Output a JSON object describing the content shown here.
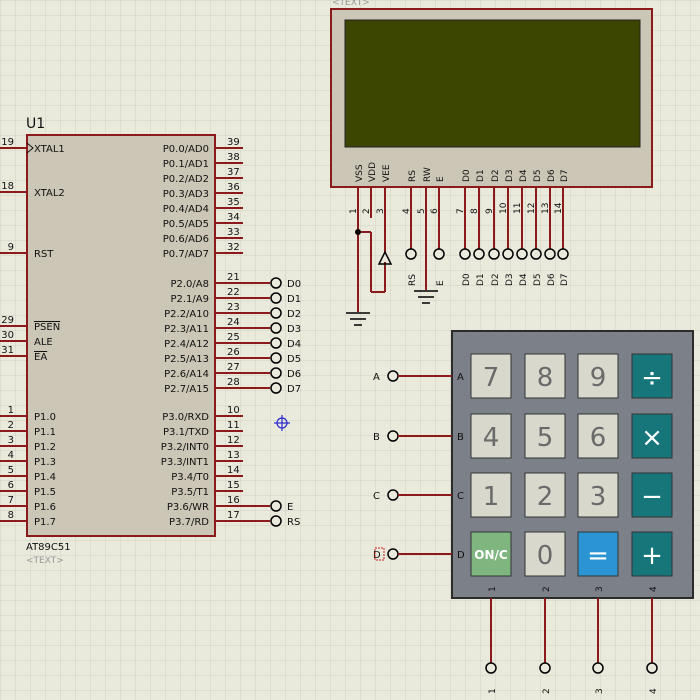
{
  "mcu": {
    "ref": "U1",
    "part": "AT89C51",
    "text_placeholder": "<TEXT>",
    "left_pins": [
      {
        "num": "19",
        "name": "XTAL1"
      },
      {
        "num": "18",
        "name": "XTAL2"
      },
      {
        "num": "9",
        "name": "RST"
      },
      {
        "num": "29",
        "name": "PSEN",
        "overline": true
      },
      {
        "num": "30",
        "name": "ALE"
      },
      {
        "num": "31",
        "name": "EA",
        "overline": true
      },
      {
        "num": "1",
        "name": "P1.0"
      },
      {
        "num": "2",
        "name": "P1.1"
      },
      {
        "num": "3",
        "name": "P1.2"
      },
      {
        "num": "4",
        "name": "P1.3"
      },
      {
        "num": "5",
        "name": "P1.4"
      },
      {
        "num": "6",
        "name": "P1.5"
      },
      {
        "num": "7",
        "name": "P1.6"
      },
      {
        "num": "8",
        "name": "P1.7"
      }
    ],
    "right_pins": [
      {
        "num": "39",
        "name": "P0.0/AD0"
      },
      {
        "num": "38",
        "name": "P0.1/AD1"
      },
      {
        "num": "37",
        "name": "P0.2/AD2"
      },
      {
        "num": "36",
        "name": "P0.3/AD3"
      },
      {
        "num": "35",
        "name": "P0.4/AD4"
      },
      {
        "num": "34",
        "name": "P0.5/AD5"
      },
      {
        "num": "33",
        "name": "P0.6/AD6"
      },
      {
        "num": "32",
        "name": "P0.7/AD7"
      },
      {
        "num": "21",
        "name": "P2.0/A8",
        "label": "D0"
      },
      {
        "num": "22",
        "name": "P2.1/A9",
        "label": "D1"
      },
      {
        "num": "23",
        "name": "P2.2/A10",
        "label": "D2"
      },
      {
        "num": "24",
        "name": "P2.3/A11",
        "label": "D3"
      },
      {
        "num": "25",
        "name": "P2.4/A12",
        "label": "D4"
      },
      {
        "num": "26",
        "name": "P2.5/A13",
        "label": "D5"
      },
      {
        "num": "27",
        "name": "P2.6/A14",
        "label": "D6"
      },
      {
        "num": "28",
        "name": "P2.7/A15",
        "label": "D7"
      },
      {
        "num": "10",
        "name": "P3.0/RXD"
      },
      {
        "num": "11",
        "name": "P3.1/TXD",
        "over": "TXD"
      },
      {
        "num": "12",
        "name": "P3.2/INT0",
        "over": "INT0"
      },
      {
        "num": "13",
        "name": "P3.3/INT1",
        "over": "INT1"
      },
      {
        "num": "14",
        "name": "P3.4/T0"
      },
      {
        "num": "15",
        "name": "P3.5/T1",
        "over": "T1"
      },
      {
        "num": "16",
        "name": "P3.6/WR",
        "over": "WR",
        "label": "E"
      },
      {
        "num": "17",
        "name": "P3.7/RD",
        "over": "RD",
        "label": "RS"
      }
    ]
  },
  "lcd": {
    "text_placeholder": "<TEXT>",
    "pins": [
      {
        "name": "VSS",
        "num": "1"
      },
      {
        "name": "VDD",
        "num": "2"
      },
      {
        "name": "VEE",
        "num": "3"
      },
      {
        "name": "RS",
        "num": "4",
        "label": "RS"
      },
      {
        "name": "RW",
        "num": "5"
      },
      {
        "name": "E",
        "num": "6",
        "label": "E"
      },
      {
        "name": "D0",
        "num": "7",
        "label": "D0"
      },
      {
        "name": "D1",
        "num": "8",
        "label": "D1"
      },
      {
        "name": "D2",
        "num": "9",
        "label": "D2"
      },
      {
        "name": "D3",
        "num": "10",
        "label": "D3"
      },
      {
        "name": "D4",
        "num": "11",
        "label": "D4"
      },
      {
        "name": "D5",
        "num": "12",
        "label": "D5"
      },
      {
        "name": "D6",
        "num": "13",
        "label": "D6"
      },
      {
        "name": "D7",
        "num": "14",
        "label": "D7"
      }
    ]
  },
  "keypad": {
    "rows": [
      "A",
      "B",
      "C",
      "D"
    ],
    "cols": [
      "1",
      "2",
      "3",
      "4"
    ],
    "keys": [
      [
        "7",
        "8",
        "9",
        "÷"
      ],
      [
        "4",
        "5",
        "6",
        "×"
      ],
      [
        "1",
        "2",
        "3",
        "−"
      ],
      [
        "ON/C",
        "0",
        "=",
        "+"
      ]
    ]
  },
  "colors": {
    "background": "#e9e9dc",
    "grid": "#d3d3c4",
    "wire": "#8b1a1a",
    "body_fill": "#cbc6b5",
    "lcd_screen": "#3d4600",
    "keypad_frame": "#7b8089",
    "key_grey": "#d8d8cc",
    "key_teal": "#16767a",
    "key_green": "#7fb57f",
    "key_blue": "#2b95d3"
  }
}
